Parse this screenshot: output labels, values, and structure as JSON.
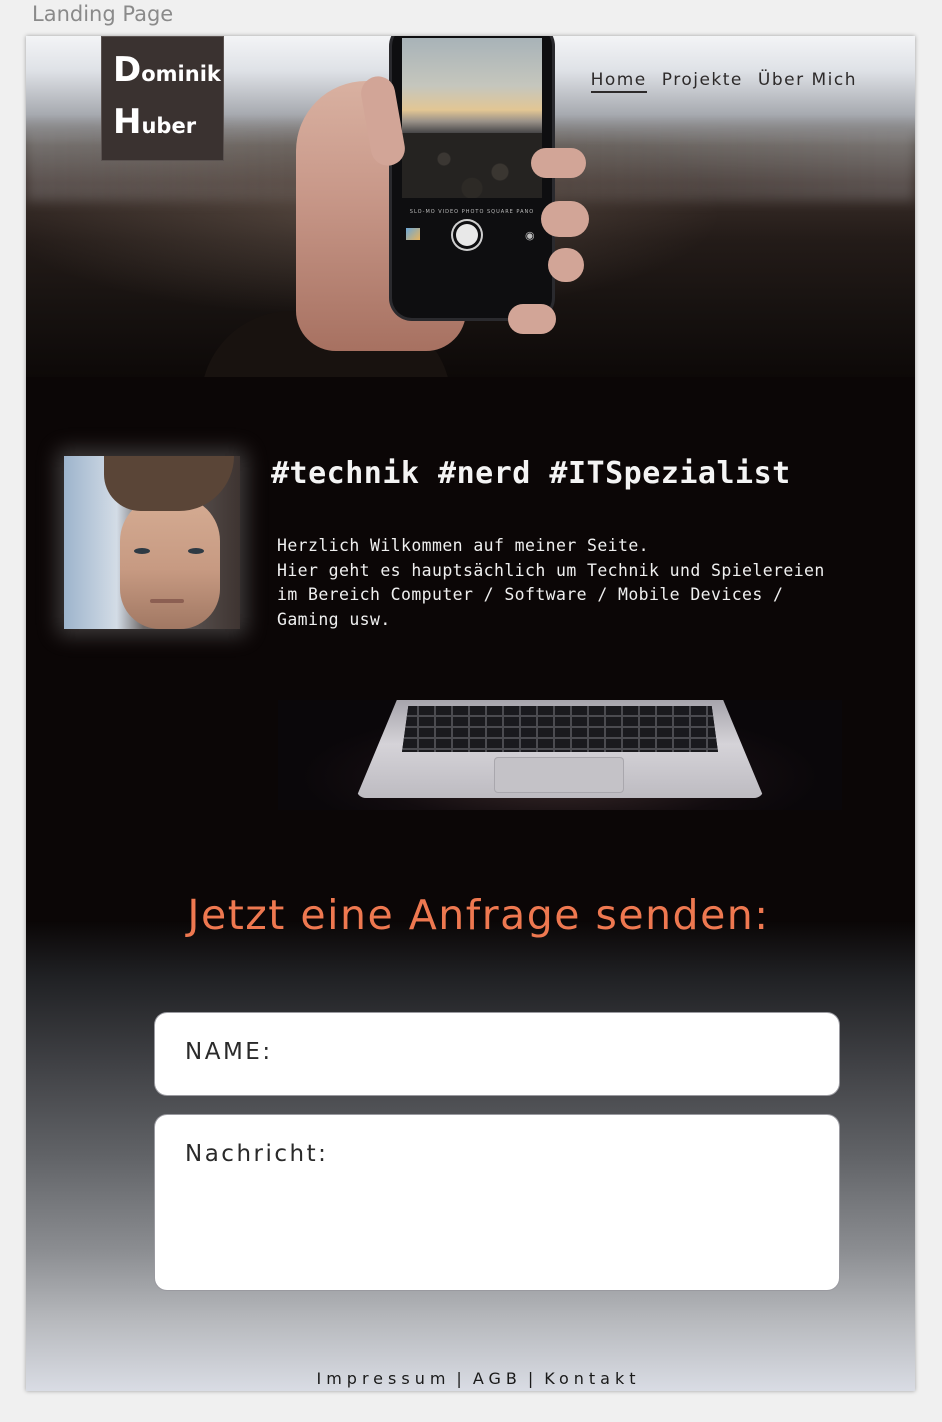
{
  "artboard": {
    "label": "Landing Page"
  },
  "logo": {
    "first_initial": "D",
    "first_rest": "ominik",
    "last_initial": "H",
    "last_rest": "uber"
  },
  "nav": {
    "items": [
      "Home",
      "Projekte",
      "Über Mich"
    ],
    "active": "Home"
  },
  "hero": {
    "camera_modes": "SLO-MO VIDEO PHOTO SQUARE PANO"
  },
  "main": {
    "headline": "#technik #nerd #ITSpezialist",
    "intro_lines": [
      "Herzlich Wilkommen auf meiner Seite.",
      "Hier geht es hauptsächlich um Technik und Spielereien",
      "im Bereich Computer / Software / Mobile Devices /",
      "Gaming usw."
    ]
  },
  "contact": {
    "title": "Jetzt eine Anfrage senden:",
    "name_label": "NAME:",
    "message_label": "Nachricht:"
  },
  "footer": {
    "links": [
      "Impressum",
      "AGB",
      "Kontakt"
    ],
    "separator": "|"
  },
  "colors": {
    "accent": "#ee7850",
    "dark_bg": "#0b0606",
    "logo_bg": "#3a3230"
  },
  "icons": [
    "camera-icon",
    "shutter-button-icon",
    "photo-thumbnail-icon"
  ]
}
